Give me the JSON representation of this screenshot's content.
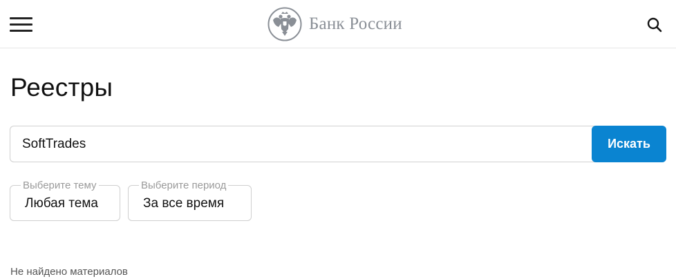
{
  "header": {
    "menu_icon": "hamburger-menu-icon",
    "logo_icon": "double-headed-eagle-emblem",
    "logo_text": "Банк России",
    "search_icon": "search-icon"
  },
  "page": {
    "title": "Реестры"
  },
  "search": {
    "value": "SoftTrades",
    "button_label": "Искать"
  },
  "filters": {
    "topic": {
      "legend": "Выберите тему",
      "value": "Любая тема"
    },
    "period": {
      "legend": "Выберите период",
      "value": "За все время"
    }
  },
  "results": {
    "empty_message": "Не найдено материалов"
  },
  "colors": {
    "accent": "#0a84d1",
    "logo_gray": "#8a8f96"
  }
}
